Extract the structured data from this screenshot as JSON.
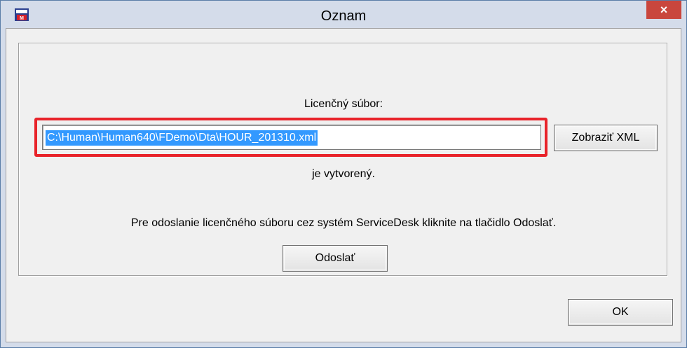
{
  "window": {
    "title": "Oznam",
    "close_label": "×"
  },
  "dialog": {
    "license_label": "Licenčný súbor:",
    "path_value": "C:\\Human\\Human640\\FDemo\\Dta\\HOUR_201310.xml",
    "show_xml_button": "Zobraziť XML",
    "created_label": "je vytvorený.",
    "info_text": "Pre odoslanie licenčného súboru cez systém ServiceDesk kliknite na tlačidlo Odoslať.",
    "send_button": "Odoslať",
    "ok_button": "OK"
  },
  "colors": {
    "highlight": "#e8232a",
    "selection": "#3399ff",
    "close_button": "#c9463d"
  }
}
